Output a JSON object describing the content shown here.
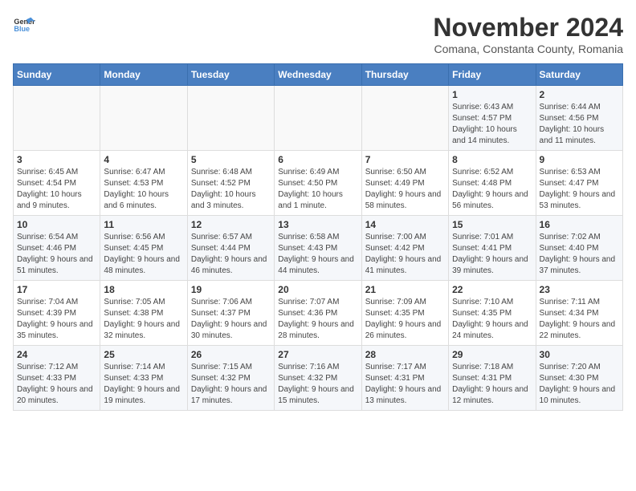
{
  "header": {
    "logo_line1": "General",
    "logo_line2": "Blue",
    "title": "November 2024",
    "subtitle": "Comana, Constanta County, Romania"
  },
  "weekdays": [
    "Sunday",
    "Monday",
    "Tuesday",
    "Wednesday",
    "Thursday",
    "Friday",
    "Saturday"
  ],
  "weeks": [
    [
      {
        "day": "",
        "info": ""
      },
      {
        "day": "",
        "info": ""
      },
      {
        "day": "",
        "info": ""
      },
      {
        "day": "",
        "info": ""
      },
      {
        "day": "",
        "info": ""
      },
      {
        "day": "1",
        "info": "Sunrise: 6:43 AM\nSunset: 4:57 PM\nDaylight: 10 hours and 14 minutes."
      },
      {
        "day": "2",
        "info": "Sunrise: 6:44 AM\nSunset: 4:56 PM\nDaylight: 10 hours and 11 minutes."
      }
    ],
    [
      {
        "day": "3",
        "info": "Sunrise: 6:45 AM\nSunset: 4:54 PM\nDaylight: 10 hours and 9 minutes."
      },
      {
        "day": "4",
        "info": "Sunrise: 6:47 AM\nSunset: 4:53 PM\nDaylight: 10 hours and 6 minutes."
      },
      {
        "day": "5",
        "info": "Sunrise: 6:48 AM\nSunset: 4:52 PM\nDaylight: 10 hours and 3 minutes."
      },
      {
        "day": "6",
        "info": "Sunrise: 6:49 AM\nSunset: 4:50 PM\nDaylight: 10 hours and 1 minute."
      },
      {
        "day": "7",
        "info": "Sunrise: 6:50 AM\nSunset: 4:49 PM\nDaylight: 9 hours and 58 minutes."
      },
      {
        "day": "8",
        "info": "Sunrise: 6:52 AM\nSunset: 4:48 PM\nDaylight: 9 hours and 56 minutes."
      },
      {
        "day": "9",
        "info": "Sunrise: 6:53 AM\nSunset: 4:47 PM\nDaylight: 9 hours and 53 minutes."
      }
    ],
    [
      {
        "day": "10",
        "info": "Sunrise: 6:54 AM\nSunset: 4:46 PM\nDaylight: 9 hours and 51 minutes."
      },
      {
        "day": "11",
        "info": "Sunrise: 6:56 AM\nSunset: 4:45 PM\nDaylight: 9 hours and 48 minutes."
      },
      {
        "day": "12",
        "info": "Sunrise: 6:57 AM\nSunset: 4:44 PM\nDaylight: 9 hours and 46 minutes."
      },
      {
        "day": "13",
        "info": "Sunrise: 6:58 AM\nSunset: 4:43 PM\nDaylight: 9 hours and 44 minutes."
      },
      {
        "day": "14",
        "info": "Sunrise: 7:00 AM\nSunset: 4:42 PM\nDaylight: 9 hours and 41 minutes."
      },
      {
        "day": "15",
        "info": "Sunrise: 7:01 AM\nSunset: 4:41 PM\nDaylight: 9 hours and 39 minutes."
      },
      {
        "day": "16",
        "info": "Sunrise: 7:02 AM\nSunset: 4:40 PM\nDaylight: 9 hours and 37 minutes."
      }
    ],
    [
      {
        "day": "17",
        "info": "Sunrise: 7:04 AM\nSunset: 4:39 PM\nDaylight: 9 hours and 35 minutes."
      },
      {
        "day": "18",
        "info": "Sunrise: 7:05 AM\nSunset: 4:38 PM\nDaylight: 9 hours and 32 minutes."
      },
      {
        "day": "19",
        "info": "Sunrise: 7:06 AM\nSunset: 4:37 PM\nDaylight: 9 hours and 30 minutes."
      },
      {
        "day": "20",
        "info": "Sunrise: 7:07 AM\nSunset: 4:36 PM\nDaylight: 9 hours and 28 minutes."
      },
      {
        "day": "21",
        "info": "Sunrise: 7:09 AM\nSunset: 4:35 PM\nDaylight: 9 hours and 26 minutes."
      },
      {
        "day": "22",
        "info": "Sunrise: 7:10 AM\nSunset: 4:35 PM\nDaylight: 9 hours and 24 minutes."
      },
      {
        "day": "23",
        "info": "Sunrise: 7:11 AM\nSunset: 4:34 PM\nDaylight: 9 hours and 22 minutes."
      }
    ],
    [
      {
        "day": "24",
        "info": "Sunrise: 7:12 AM\nSunset: 4:33 PM\nDaylight: 9 hours and 20 minutes."
      },
      {
        "day": "25",
        "info": "Sunrise: 7:14 AM\nSunset: 4:33 PM\nDaylight: 9 hours and 19 minutes."
      },
      {
        "day": "26",
        "info": "Sunrise: 7:15 AM\nSunset: 4:32 PM\nDaylight: 9 hours and 17 minutes."
      },
      {
        "day": "27",
        "info": "Sunrise: 7:16 AM\nSunset: 4:32 PM\nDaylight: 9 hours and 15 minutes."
      },
      {
        "day": "28",
        "info": "Sunrise: 7:17 AM\nSunset: 4:31 PM\nDaylight: 9 hours and 13 minutes."
      },
      {
        "day": "29",
        "info": "Sunrise: 7:18 AM\nSunset: 4:31 PM\nDaylight: 9 hours and 12 minutes."
      },
      {
        "day": "30",
        "info": "Sunrise: 7:20 AM\nSunset: 4:30 PM\nDaylight: 9 hours and 10 minutes."
      }
    ]
  ]
}
